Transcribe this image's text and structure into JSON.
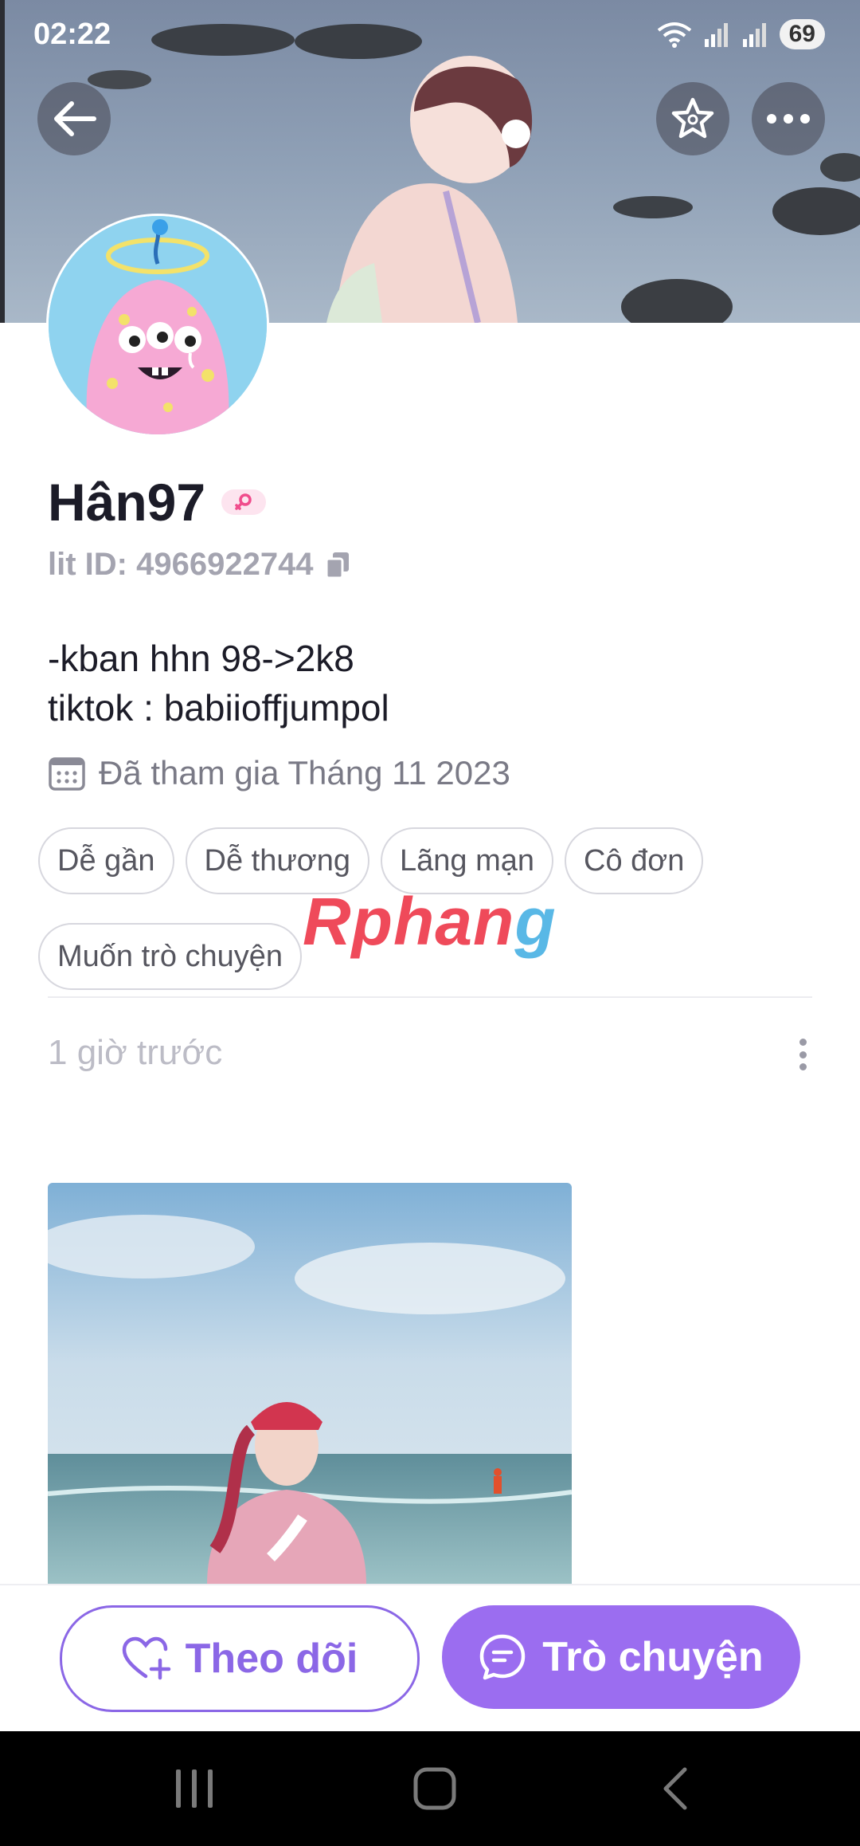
{
  "status_bar": {
    "time": "02:22",
    "battery": "69"
  },
  "profile": {
    "username": "Hân97",
    "lit_id": "lit ID: 4966922744",
    "bio_lines": [
      "-kban hhn 98->2k8",
      "tiktok : babiioffjumpol"
    ],
    "joined": "Đã tham gia Tháng 11 2023"
  },
  "tags": [
    "Dễ gần",
    "Dễ thương",
    "Lãng mạn",
    "Cô đơn",
    "Muốn trò chuyện"
  ],
  "watermark": {
    "part1": "Rphan",
    "part2": "g"
  },
  "post": {
    "time": "1 giờ trước"
  },
  "actions": {
    "follow_label": "Theo dõi",
    "chat_label": "Trò chuyện"
  },
  "icons": {
    "back": "arrow-left-icon",
    "favorite": "star-icon",
    "more": "more-horizontal-icon",
    "copy": "copy-icon",
    "calendar": "calendar-icon",
    "gender": "female-icon",
    "follow": "heart-plus-icon",
    "chat": "chat-bubble-icon",
    "nav_recents": "recents-icon",
    "nav_home": "home-icon",
    "nav_back": "back-icon"
  },
  "colors": {
    "accent": "#9b6df0",
    "accent_outline": "#8b67e6",
    "tag_border": "#d7d7de",
    "muted_text": "#a4a4b0"
  }
}
